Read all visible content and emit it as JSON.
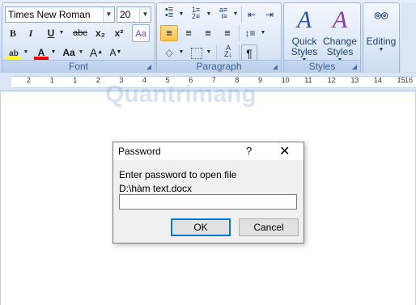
{
  "font": {
    "name": "Times New Roman",
    "size": "20",
    "group_label": "Font",
    "buttons": [
      "B",
      "I",
      "U",
      "abc",
      "x₂",
      "x²",
      "A",
      "A",
      "Aa",
      "A",
      "A"
    ]
  },
  "paragraph": {
    "group_label": "Paragraph",
    "pilcrow": "¶"
  },
  "styles": {
    "group_label": "Styles",
    "quick_styles": "Quick Styles",
    "change_styles": "Change Styles",
    "styles_icon_glyph": "A"
  },
  "editing": {
    "label": "Editing"
  },
  "ruler": {
    "numbers": [
      "2",
      "1",
      "1",
      "2",
      "3",
      "4",
      "5",
      "6",
      "7",
      "8",
      "9",
      "10",
      "11",
      "12",
      "13",
      "14",
      "15",
      "16"
    ]
  },
  "watermark": {
    "text": "Quantrimang"
  },
  "dialog": {
    "title": "Password",
    "help": "?",
    "close": "✕",
    "prompt": "Enter password to open file",
    "file_path": "D:\\hàm text.docx",
    "password_value": "",
    "ok": "OK",
    "cancel": "Cancel"
  },
  "colors": {
    "highlight": "#ffff00",
    "font_color": "#ff0000",
    "active_button": "#ffc54a",
    "dialog_default_border": "#0078d7"
  }
}
